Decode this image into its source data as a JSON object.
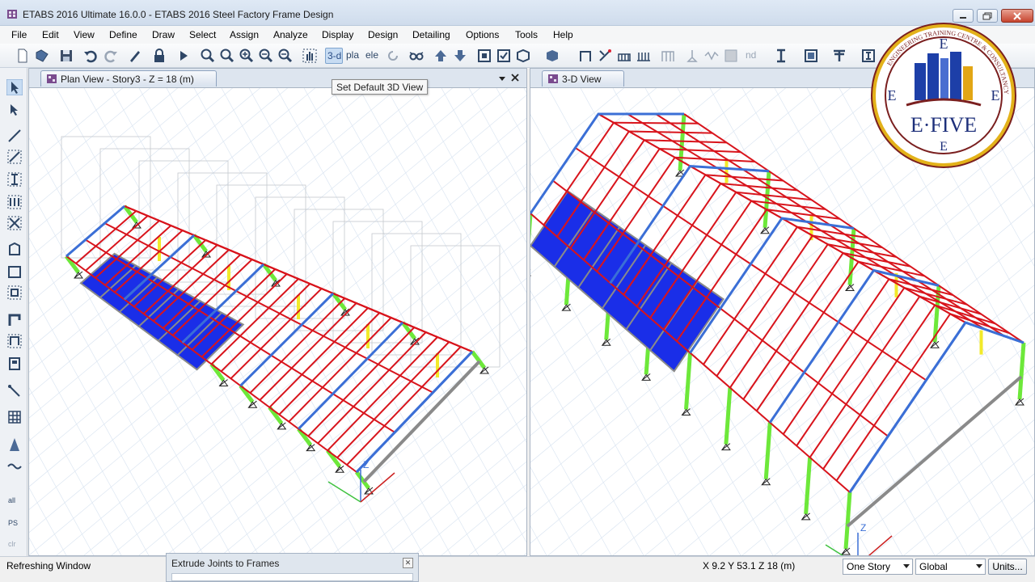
{
  "window": {
    "title": "ETABS 2016 Ultimate 16.0.0 - ETABS 2016 Steel Factory Frame Design"
  },
  "menu": [
    "File",
    "Edit",
    "View",
    "Define",
    "Draw",
    "Select",
    "Assign",
    "Analyze",
    "Display",
    "Design",
    "Detailing",
    "Options",
    "Tools",
    "Help"
  ],
  "toolbar": {
    "view_3d_label": "3-d",
    "plan_label": "pla",
    "elev_label": "ele",
    "nd_label": "nd"
  },
  "tooltip": {
    "text": "Set Default 3D View"
  },
  "panes": {
    "plan": {
      "title": "Plan View - Story3 - Z = 18 (m)"
    },
    "view3d": {
      "title": "3-D View"
    }
  },
  "left_tools": {
    "all_label": "all",
    "ps_label": "PS",
    "clr_label": "clr"
  },
  "axis_labels": {
    "z": "Z"
  },
  "logo": {
    "text": "E·FIVE",
    "letter": "E",
    "ring_text": "ENGINEERING TRAINING CENTRE & CONSULTANCY"
  },
  "status": {
    "message": "Refreshing Window",
    "panel_title": "Extrude Joints to Frames",
    "coordinates": "X 9.2  Y 53.1  Z 18 (m)",
    "story_select": "One Story",
    "coord_system": "Global",
    "units_button": "Units..."
  },
  "colors": {
    "frame_red": "#d8141c",
    "column_green": "#6de83a",
    "slab_blue": "#1a2ee8",
    "brace_blue": "#3b6fd6",
    "beam_gray": "#8a8a8a",
    "yellow": "#f2ea2a"
  }
}
